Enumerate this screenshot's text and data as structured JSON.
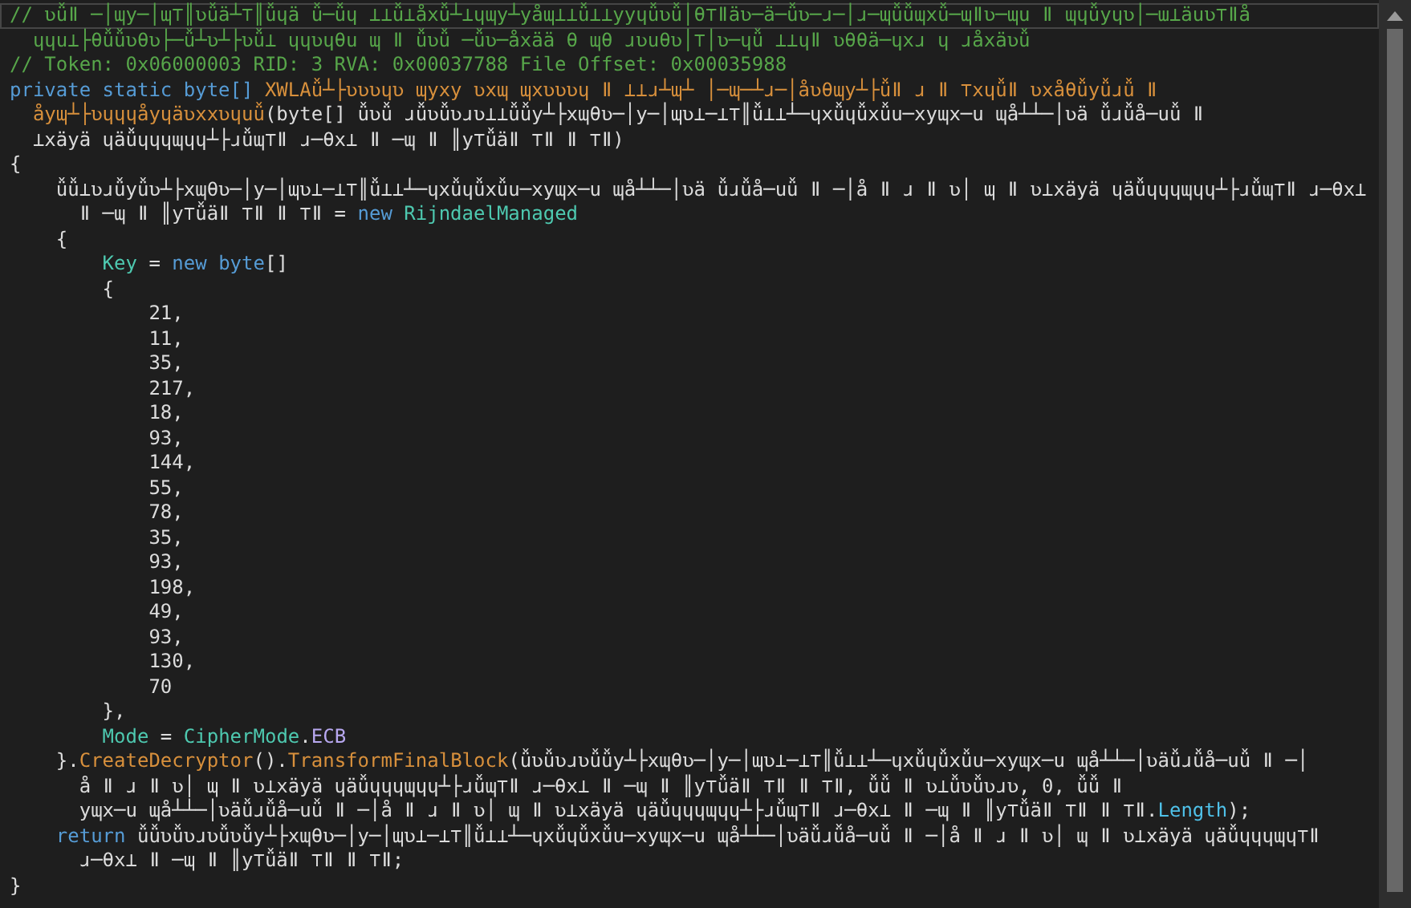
{
  "editor": {
    "lines": [
      {
        "selected": true,
        "tokens": [
          {
            "kind": "comment",
            "text": "// ʋǚǁ ─│ɰy─│ɰ⊤║ʋǚä┴⊤║ǚɥä ǚ─ǚɥ ⊥⊥ǚ⊥åxǚ┴⊥ɥɰy┴yåɰ⊥⊥ǚ⊥⊥yyɥǚʋǚ│θ⊤ǁäʋ─ä─ǚʋ─ɹ─│ɹ─ɰǚǚɰxǚ─ɰǁʋ─ɰu ǁ ɰɥǚyɥʋ│─ɯ⊥äuʋ⊤ǁå"
          }
        ]
      },
      {
        "selected": false,
        "tokens": [
          {
            "kind": "comment",
            "text": "  ɥɥu⊥├θǚǚʋθʋ├─ǚ┴ʋ┴├ʋǚ⊥ ɥɥʋɥθu ɰ ǁ ǚʋǚ ─ǚʋ─åxää θ ɰθ ɹʋuθʋ│⊤│ʋ─ɥǚ ⊥⊥ɥǁ ʋθθä─ɥxɹ ɥ ɹåxäʋǚ"
          }
        ]
      },
      {
        "selected": false,
        "tokens": [
          {
            "kind": "comment",
            "text": "// Token: 0x06000003 RID: 3 RVA: 0x00037788 File Offset: 0x00035988"
          }
        ]
      },
      {
        "selected": false,
        "tokens": [
          {
            "kind": "keyword",
            "text": "private static byte[] "
          },
          {
            "kind": "method",
            "text": "XWLAǚ┴├ʋʋʋɥʋ ɰyxy ʋxɰ ɰxʋʋʋɥ ǁ ⊥⊥ɹ┴ɰ┴ │─ɰ─┴ɹ─│åʋθɰy┴├ǚǁ ɹ ǁ ⊤xɥǚǁ ʋxåθǚyǚɹǚ ǁ"
          }
        ]
      },
      {
        "selected": false,
        "tokens": [
          {
            "kind": "method",
            "text": "  åyɰ┴├ʋɥɥɥåyɥäʋxxʋɥuǚ"
          },
          {
            "kind": "plain",
            "text": "(byte[] ǚʋǚ ɹǚʋǚʋɹʋ⊥⊥ǚǚy┴├xɰθʋ─│y─│ɰʋ⊥─⊥⊤║ǚ⊥⊥┴─ɥxǚɥǚxǚu─xyɰx─u ɰå┴┴─│ʋä ǚɹǚå─uǚ ǁ"
          }
        ]
      },
      {
        "selected": false,
        "tokens": [
          {
            "kind": "plain",
            "text": "  ⊥xäyä ɥäǚɥɥɥɰɥɥ┴├ɹǚɰ⊤ǁ ɹ─θx⊥ ǁ ─ɰ ǁ ║y⊤ǚäǁ ⊤ǁ ǁ ⊤ǁ)"
          }
        ]
      },
      {
        "selected": false,
        "tokens": [
          {
            "kind": "plain",
            "text": "{"
          }
        ]
      },
      {
        "selected": false,
        "tokens": [
          {
            "kind": "plain",
            "text": "    ǚǚ⊥ʋɹǚyǚʋ┴├xɰθʋ─│y─│ɰʋ⊥─⊥⊤║ǚ⊥⊥┴─ɥxǚɥǚxǚu─xyɰx─u ɰå┴┴─│ʋä ǚɹǚå─uǚ ǁ ─│å ǁ ɹ ǁ ʋ│ ɰ ǁ ʋ⊥xäyä ɥäǚɥɥɥɰɥɥ┴├ɹǚɰ⊤ǁ ɹ─θx⊥"
          }
        ]
      },
      {
        "selected": false,
        "tokens": [
          {
            "kind": "plain",
            "text": "      ǁ ─ɰ ǁ ║y⊤ǚäǁ ⊤ǁ ǁ ⊤ǁ = "
          },
          {
            "kind": "keyword",
            "text": "new "
          },
          {
            "kind": "type",
            "text": "RijndaelManaged"
          }
        ]
      },
      {
        "selected": false,
        "tokens": [
          {
            "kind": "plain",
            "text": "    {"
          }
        ]
      },
      {
        "selected": false,
        "tokens": [
          {
            "kind": "property",
            "text": "        Key"
          },
          {
            "kind": "plain",
            "text": " = "
          },
          {
            "kind": "keyword",
            "text": "new byte"
          },
          {
            "kind": "plain",
            "text": "[]"
          }
        ]
      },
      {
        "selected": false,
        "tokens": [
          {
            "kind": "plain",
            "text": "        {"
          }
        ]
      },
      {
        "selected": false,
        "tokens": [
          {
            "kind": "plain",
            "text": "            21,"
          }
        ]
      },
      {
        "selected": false,
        "tokens": [
          {
            "kind": "plain",
            "text": "            11,"
          }
        ]
      },
      {
        "selected": false,
        "tokens": [
          {
            "kind": "plain",
            "text": "            35,"
          }
        ]
      },
      {
        "selected": false,
        "tokens": [
          {
            "kind": "plain",
            "text": "            217,"
          }
        ]
      },
      {
        "selected": false,
        "tokens": [
          {
            "kind": "plain",
            "text": "            18,"
          }
        ]
      },
      {
        "selected": false,
        "tokens": [
          {
            "kind": "plain",
            "text": "            93,"
          }
        ]
      },
      {
        "selected": false,
        "tokens": [
          {
            "kind": "plain",
            "text": "            144,"
          }
        ]
      },
      {
        "selected": false,
        "tokens": [
          {
            "kind": "plain",
            "text": "            55,"
          }
        ]
      },
      {
        "selected": false,
        "tokens": [
          {
            "kind": "plain",
            "text": "            78,"
          }
        ]
      },
      {
        "selected": false,
        "tokens": [
          {
            "kind": "plain",
            "text": "            35,"
          }
        ]
      },
      {
        "selected": false,
        "tokens": [
          {
            "kind": "plain",
            "text": "            93,"
          }
        ]
      },
      {
        "selected": false,
        "tokens": [
          {
            "kind": "plain",
            "text": "            198,"
          }
        ]
      },
      {
        "selected": false,
        "tokens": [
          {
            "kind": "plain",
            "text": "            49,"
          }
        ]
      },
      {
        "selected": false,
        "tokens": [
          {
            "kind": "plain",
            "text": "            93,"
          }
        ]
      },
      {
        "selected": false,
        "tokens": [
          {
            "kind": "plain",
            "text": "            130,"
          }
        ]
      },
      {
        "selected": false,
        "tokens": [
          {
            "kind": "plain",
            "text": "            70"
          }
        ]
      },
      {
        "selected": false,
        "tokens": [
          {
            "kind": "plain",
            "text": "        },"
          }
        ]
      },
      {
        "selected": false,
        "tokens": [
          {
            "kind": "property",
            "text": "        Mode"
          },
          {
            "kind": "plain",
            "text": " = "
          },
          {
            "kind": "type",
            "text": "CipherMode"
          },
          {
            "kind": "plain",
            "text": "."
          },
          {
            "kind": "field",
            "text": "ECB"
          }
        ]
      },
      {
        "selected": false,
        "tokens": [
          {
            "kind": "plain",
            "text": "    }."
          },
          {
            "kind": "method",
            "text": "CreateDecryptor"
          },
          {
            "kind": "plain",
            "text": "()."
          },
          {
            "kind": "method",
            "text": "TransformFinalBlock"
          },
          {
            "kind": "plain",
            "text": "(ǚʋǚʋɹʋǚǚy┴├xɰθʋ─│y─│ɰʋ⊥─⊥⊤║ǚ⊥⊥┴─ɥxǚɥǚxǚu─xyɰx─u ɰå┴┴─│ʋäǚɹǚå─uǚ ǁ ─│"
          }
        ]
      },
      {
        "selected": false,
        "tokens": [
          {
            "kind": "plain",
            "text": "      å ǁ ɹ ǁ ʋ│ ɰ ǁ ʋ⊥xäyä ɥäǚɥɥɥɰɥɥ┴├ɹǚɰ⊤ǁ ɹ─θx⊥ ǁ ─ɰ ǁ ║y⊤ǚäǁ ⊤ǁ ǁ ⊤ǁ, ǚǚ ǁ ʋ⊥ǚʋǚʋɹʋ, 0, ǚǚ ǁ"
          }
        ]
      },
      {
        "selected": false,
        "tokens": [
          {
            "kind": "plain",
            "text": "      yɰx─u ɰå┴┴─│ʋäǚɹǚå─uǚ ǁ ─│å ǁ ɹ ǁ ʋ│ ɰ ǁ ʋ⊥xäyä ɥäǚɥɥɥɰɥɥ┴├ɹǚɰ⊤ǁ ɹ─θx⊥ ǁ ─ɰ ǁ ║y⊤ǚäǁ ⊤ǁ ǁ ⊤ǁ."
          },
          {
            "kind": "field2",
            "text": "Length"
          },
          {
            "kind": "plain",
            "text": ");"
          }
        ]
      },
      {
        "selected": false,
        "tokens": [
          {
            "kind": "keyword",
            "text": "    return "
          },
          {
            "kind": "plain",
            "text": "ǚǚʋǚʋɹʋǚʋǚy┴├xɰθʋ─│y─│ɰʋ⊥─⊥⊤║ǚ⊥⊥┴─ɥxǚɥǚxǚu─xyɰx─u ɰå┴┴─│ʋäǚɹǚå─uǚ ǁ ─│å ǁ ɹ ǁ ʋ│ ɰ ǁ ʋ⊥xäyä ɥäǚɥɥɥɰɥ⊤ǁ"
          }
        ]
      },
      {
        "selected": false,
        "tokens": [
          {
            "kind": "plain",
            "text": "      ɹ─θx⊥ ǁ ─ɰ ǁ ║y⊤ǚäǁ ⊤ǁ ǁ ⊤ǁ;"
          }
        ]
      },
      {
        "selected": false,
        "tokens": [
          {
            "kind": "plain",
            "text": "}"
          }
        ]
      }
    ]
  }
}
